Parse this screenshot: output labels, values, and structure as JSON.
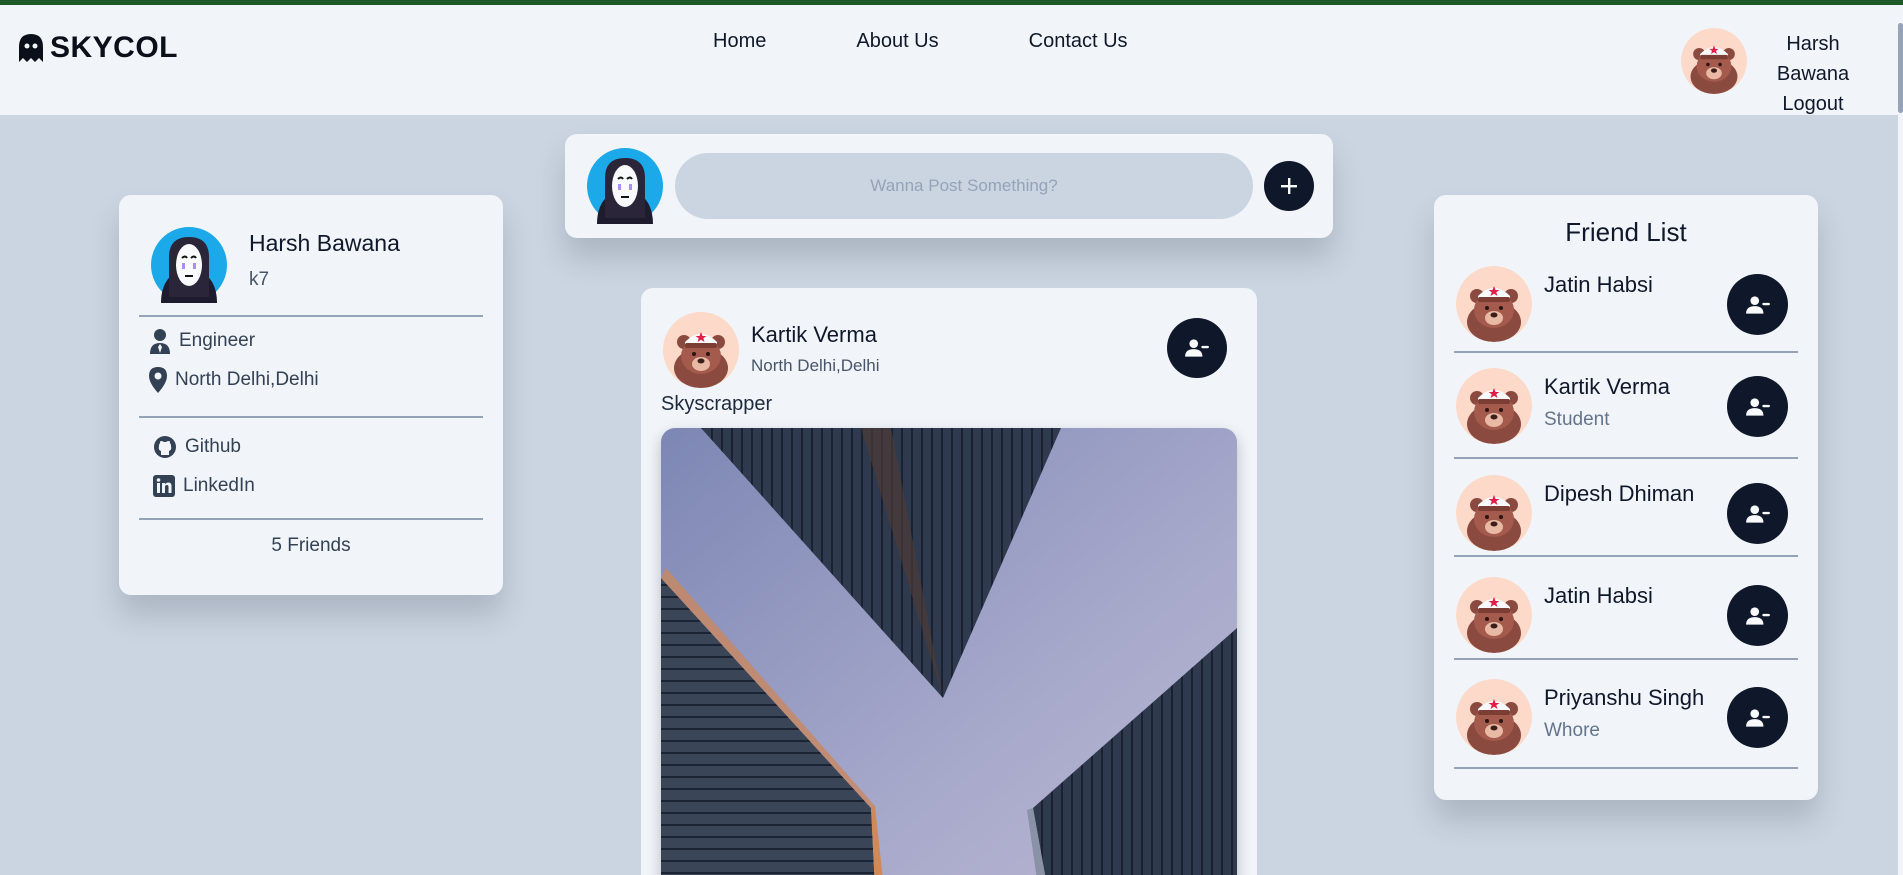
{
  "app": {
    "brand": "SKYCOL",
    "accent": "#1e5a28"
  },
  "nav": [
    {
      "label": "Home"
    },
    {
      "label": "About Us"
    },
    {
      "label": "Contact Us"
    }
  ],
  "header_user": {
    "name": "Harsh Bawana",
    "logout": "Logout"
  },
  "profile": {
    "name": "Harsh Bawana",
    "username": "k7",
    "occupation": "Engineer",
    "location": "North Delhi,Delhi",
    "github": "Github",
    "linkedin": "LinkedIn",
    "friends_count": "5 Friends"
  },
  "composer": {
    "placeholder": "Wanna Post Something?"
  },
  "post": {
    "author": "Kartik Verma",
    "location": "North Delhi,Delhi",
    "caption": "Skyscrapper"
  },
  "friends": {
    "title": "Friend List",
    "items": [
      {
        "name": "Jatin Habsi",
        "subtitle": ""
      },
      {
        "name": "Kartik Verma",
        "subtitle": "Student"
      },
      {
        "name": "Dipesh Dhiman",
        "subtitle": ""
      },
      {
        "name": "Jatin Habsi",
        "subtitle": ""
      },
      {
        "name": "Priyanshu Singh",
        "subtitle": "Whore"
      }
    ]
  },
  "icons": {
    "logo": "ghost-icon",
    "add": "plus-icon",
    "remove_friend": "user-minus-icon",
    "occupation": "user-tie-icon",
    "location": "map-pin-icon",
    "github": "github-icon",
    "linkedin": "linkedin-icon"
  }
}
